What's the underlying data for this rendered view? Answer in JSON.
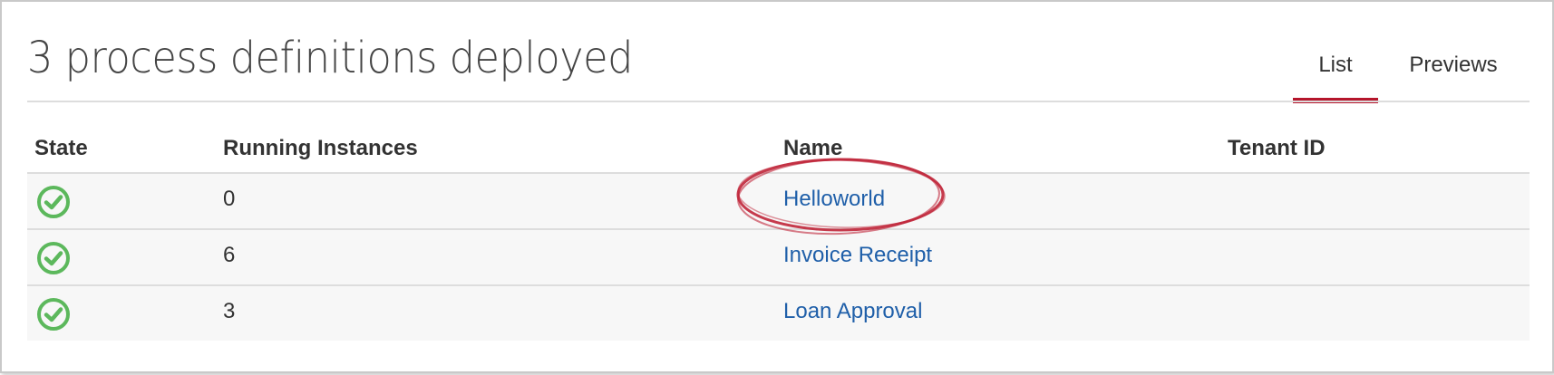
{
  "page": {
    "title": "3 process definitions deployed"
  },
  "tabs": [
    {
      "label": "List",
      "active": true
    },
    {
      "label": "Previews",
      "active": false
    }
  ],
  "table": {
    "headers": {
      "state": "State",
      "running": "Running Instances",
      "name": "Name",
      "tenant": "Tenant ID"
    },
    "rows": [
      {
        "state_icon": "check-circle-icon",
        "running": "0",
        "name": "Helloworld",
        "tenant": ""
      },
      {
        "state_icon": "check-circle-icon",
        "running": "6",
        "name": "Invoice Receipt",
        "tenant": ""
      },
      {
        "state_icon": "check-circle-icon",
        "running": "3",
        "name": "Loan Approval",
        "tenant": ""
      }
    ]
  },
  "colors": {
    "accent": "#b5152b",
    "link": "#1f5fa9",
    "ok_green": "#5cb85c",
    "highlight_circle": "#c0263a"
  }
}
